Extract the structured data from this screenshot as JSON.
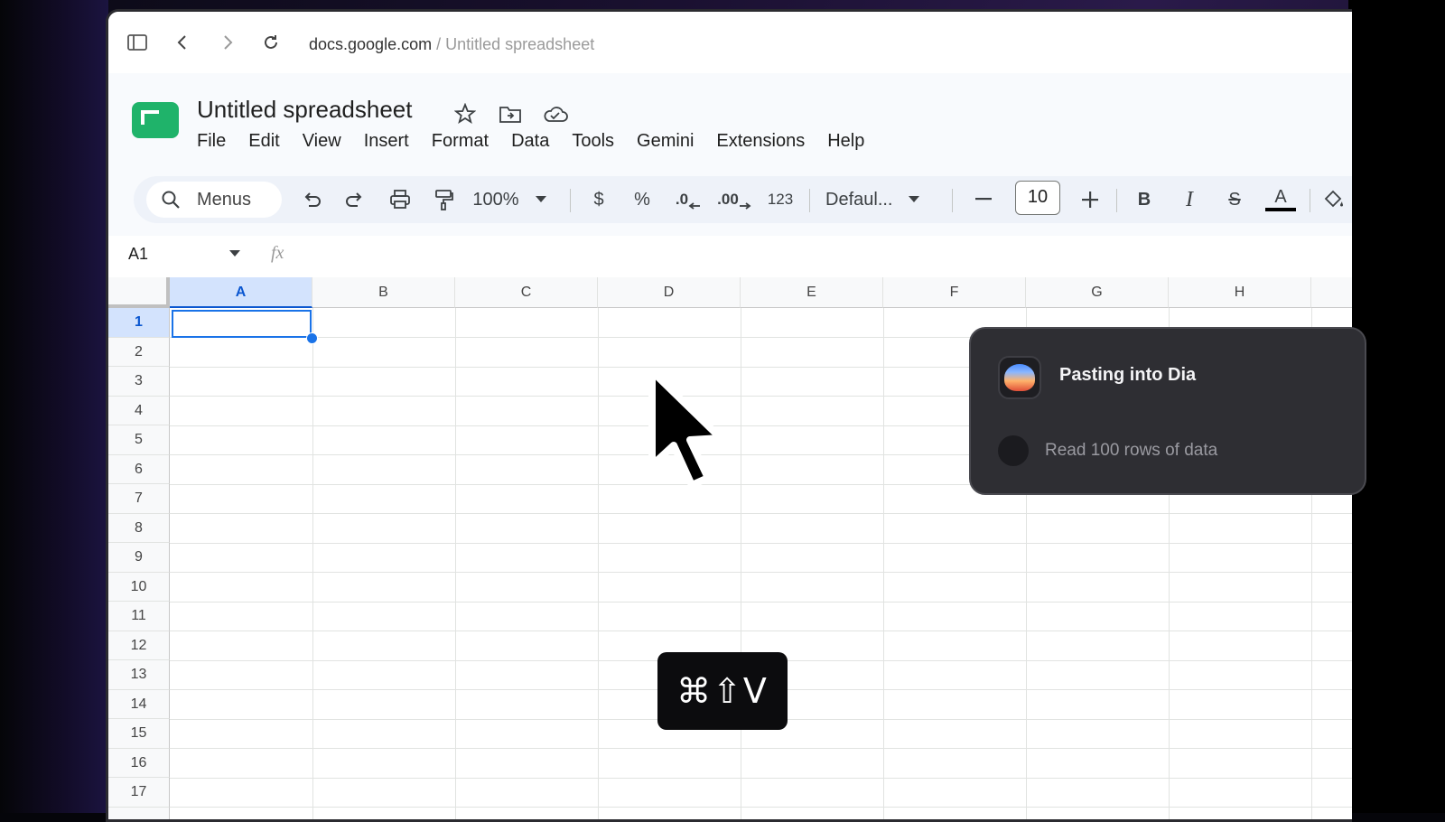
{
  "browser": {
    "domain": "docs.google.com",
    "separator": " / ",
    "page": "Untitled spreadsheet"
  },
  "doc": {
    "title": "Untitled spreadsheet"
  },
  "menu": [
    "File",
    "Edit",
    "View",
    "Insert",
    "Format",
    "Data",
    "Tools",
    "Gemini",
    "Extensions",
    "Help"
  ],
  "toolbar": {
    "search_label": "Menus",
    "zoom": "100%",
    "currency": "$",
    "percent": "%",
    "dec_decrease": ".0",
    "dec_increase": ".00",
    "number_format": "123",
    "font": "Defaul...",
    "font_size": "10",
    "bold": "B",
    "italic": "I",
    "strike": "S",
    "text_color": "A"
  },
  "formula_bar": {
    "cell_ref": "A1",
    "fx": "fx"
  },
  "grid": {
    "columns": [
      "A",
      "B",
      "C",
      "D",
      "E",
      "F",
      "G",
      "H"
    ],
    "rows": [
      "1",
      "2",
      "3",
      "4",
      "5",
      "6",
      "7",
      "8",
      "9",
      "10",
      "11",
      "12",
      "13",
      "14",
      "15",
      "16",
      "17"
    ],
    "selected_cell": "A1"
  },
  "toast": {
    "title": "Pasting into Dia",
    "status": "Read 100 rows of data"
  },
  "shortcut": {
    "keys": "⌘⇧V"
  },
  "colors": {
    "accent": "#1a73e8",
    "sheets_green": "#1fb36a",
    "toast_bg": "#2e2e33"
  }
}
